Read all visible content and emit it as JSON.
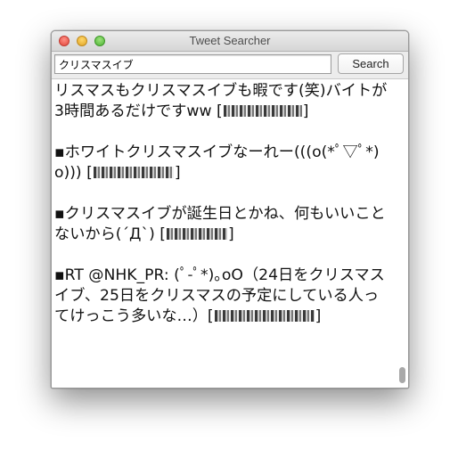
{
  "window": {
    "title": "Tweet Searcher"
  },
  "search": {
    "query": "クリスマスイブ",
    "button_label": "Search"
  },
  "tweets": [
    {
      "text": "リスマスもクリスマスイブも暇です(笑)バイトが3時間あるだけですww [",
      "close": "]"
    },
    {
      "text": "▪ホワイトクリスマスイブなーれー(((o(*ﾟ▽ﾟ*)o))) [",
      "close": "]"
    },
    {
      "text": "▪クリスマスイブが誕生日とかね、何もいいことないから(´Д`) [",
      "close": "]"
    },
    {
      "text": "▪RT @NHK_PR: (ﾟ-ﾟ*)｡oO（24日をクリスマスイブ、25日をクリスマスの予定にしている人ってけっこう多いな…）[",
      "close": "]"
    }
  ],
  "colors": {
    "close": "#e2463c",
    "minimize": "#e0a526",
    "zoom": "#4fb334"
  }
}
